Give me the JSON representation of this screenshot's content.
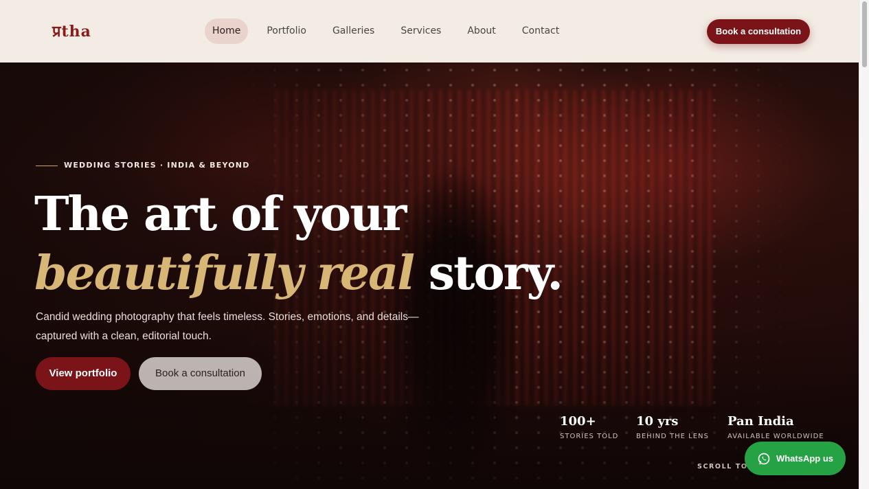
{
  "header": {
    "logo": "प्रtha",
    "nav": [
      "Home",
      "Portfolio",
      "Galleries",
      "Services",
      "About",
      "Contact"
    ],
    "active_nav": "Home",
    "cta": "Book a consultation"
  },
  "hero": {
    "eyebrow": "WEDDING STORIES · INDIA & BEYOND",
    "headline_line1": "The art of your",
    "headline_accent": "beautifully real",
    "headline_end": " story.",
    "subtitle": "Candid wedding photography that feels timeless. Stories, emotions, and details—captured with a clean, editorial touch.",
    "primary_button": "View portfolio",
    "secondary_button": "Book a consultation",
    "stats": [
      {
        "value": "100+",
        "label": "STORIES TOLD"
      },
      {
        "value": "10 yrs",
        "label": "BEHIND THE LENS"
      },
      {
        "value": "Pan India",
        "label": "AVAILABLE WORLDWIDE"
      }
    ],
    "scroll_hint": "SCROLL TO D"
  },
  "whatsapp": {
    "label": "WhatsApp us",
    "icon": "whatsapp-icon"
  },
  "colors": {
    "brand": "#7a1418",
    "accent": "#d7b676",
    "header_bg": "#f3ece5",
    "whatsapp": "#25a244"
  }
}
